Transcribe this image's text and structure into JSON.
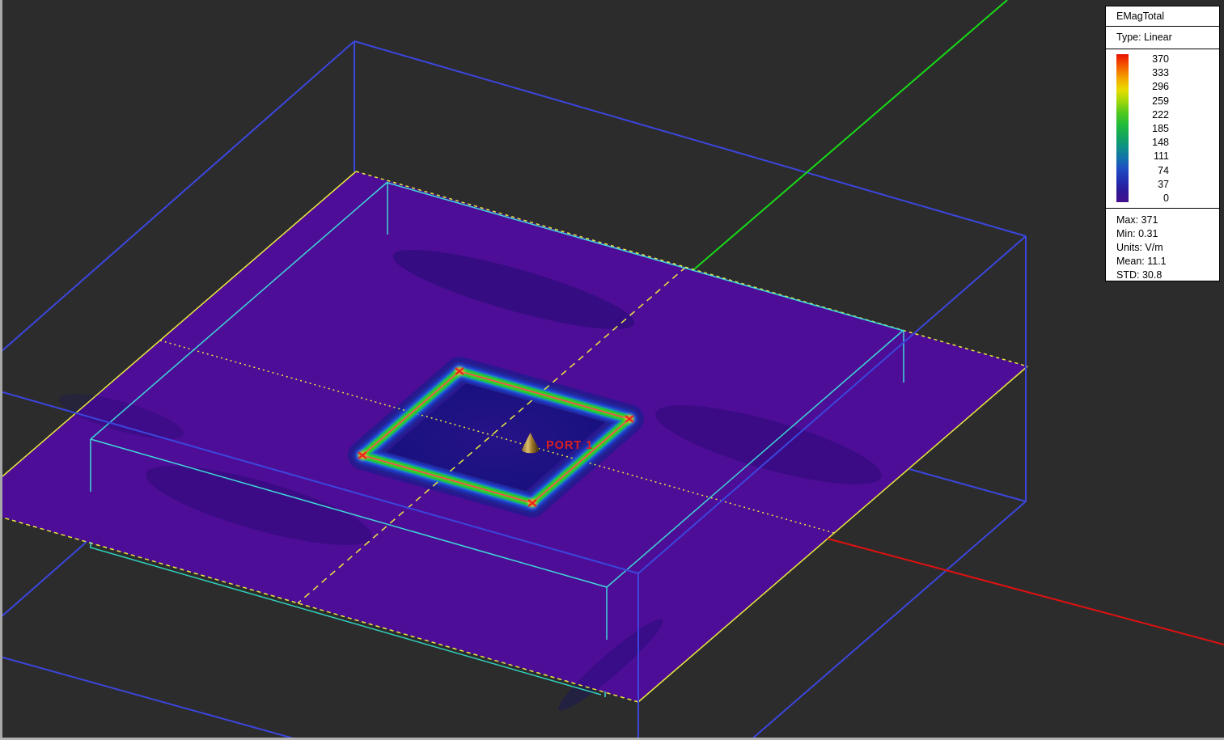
{
  "legend": {
    "title": "EMagTotal",
    "type_label": "Type: Linear",
    "scale_values": [
      "370",
      "333",
      "296",
      "259",
      "222",
      "185",
      "148",
      "111",
      "74",
      "37",
      "0"
    ],
    "stats": [
      "Max: 371",
      "Min: 0.31",
      "Units: V/m",
      "Mean: 11.1",
      "STD: 30.8"
    ],
    "colorbar_colors": [
      "#e81200",
      "#f56300",
      "#f3ab00",
      "#e8dc00",
      "#a8d808",
      "#4cc81e",
      "#1fbb3a",
      "#12a35f",
      "#0e8f86",
      "#1272aa",
      "#1e4fc2",
      "#2330b2",
      "#2c1b98",
      "#450f8e"
    ]
  },
  "viewport": {
    "port_label": "PORT 1",
    "colors": {
      "background": "#2c2c2c",
      "air_box_wire": "#3b46dd",
      "inner_box_wire": "#3ed8d8",
      "inner_box_bottom_wire": "#2fd0bc",
      "plane_fill": "#4e0d96",
      "plane_edge": "#e9e93e",
      "x_axis": "#e01111",
      "y_axis": "#17db17",
      "slot_outline": "#f05050",
      "corner_marker": "#ef2020",
      "port_label_color": "#dd1f1f"
    }
  }
}
